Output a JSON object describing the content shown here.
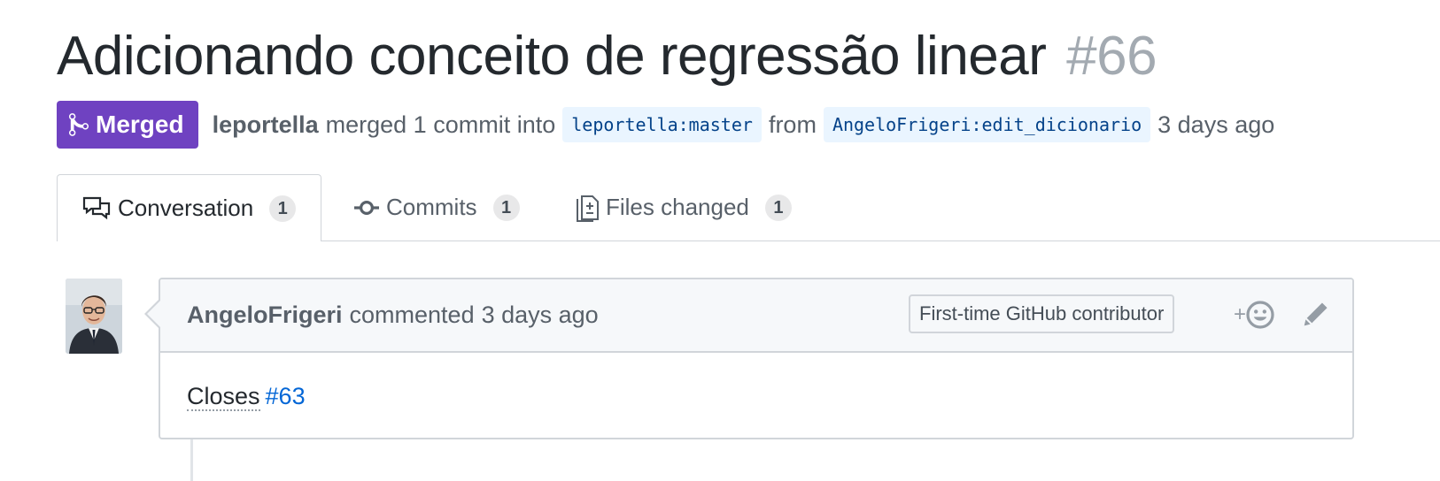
{
  "pull_request": {
    "title": "Adicionando conceito de regressão linear",
    "number": "#66",
    "state": "Merged",
    "state_icon": "git-merge-icon",
    "author": "leportella",
    "action_text": "merged 1 commit into",
    "base_branch": "leportella:master",
    "from_text": "from",
    "head_branch": "AngeloFrigeri:edit_dicionario",
    "time": "3 days ago"
  },
  "tabs": [
    {
      "label": "Conversation",
      "count": "1",
      "icon": "comment-discussion-icon",
      "selected": true
    },
    {
      "label": "Commits",
      "count": "1",
      "icon": "git-commit-icon",
      "selected": false
    },
    {
      "label": "Files changed",
      "count": "1",
      "icon": "file-diff-icon",
      "selected": false
    }
  ],
  "comment": {
    "author": "AngeloFrigeri",
    "action": "commented",
    "time": "3 days ago",
    "label": "First-time GitHub contributor",
    "reaction_plus": "+",
    "reaction_icon": "smiley-icon",
    "edit_icon": "pencil-icon",
    "body_text": "Closes",
    "body_link": "#63"
  },
  "colors": {
    "merged": "#6f42c1",
    "link": "#0366d6",
    "branch_bg": "#eaf5ff",
    "branch_text": "#044289"
  }
}
